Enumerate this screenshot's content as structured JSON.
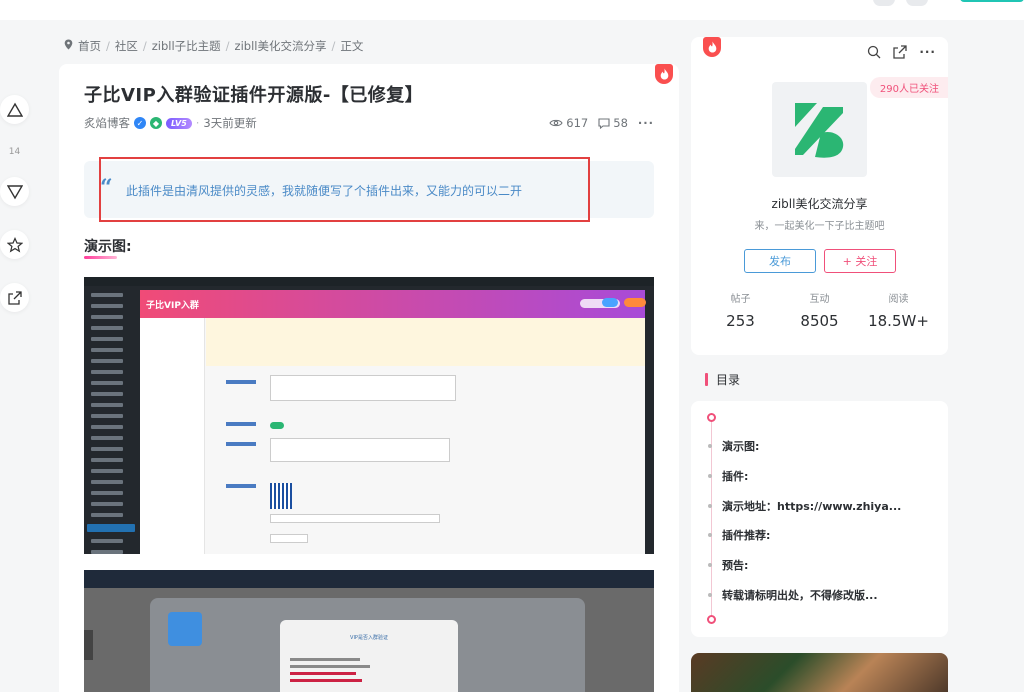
{
  "breadcrumb": {
    "home": "首页",
    "items": [
      "社区",
      "zibll子比主题",
      "zibll美化交流分享",
      "正文"
    ]
  },
  "vote": {
    "count": "14"
  },
  "post": {
    "title": "子比VIP入群验证插件开源版-【已修复】",
    "author": "炙焰博客",
    "level": "LV5",
    "updated": "3天前更新",
    "views": "617",
    "comments": "58",
    "quote": "此插件是由清风提供的灵感，我就随便写了个插件出来，又能力的可以二开",
    "section_heading": "演示图:",
    "screenshot1_title": "子比VIP入群",
    "screenshot2_dialog_title": "VIP是否入群验证"
  },
  "forum_card": {
    "followers": "290人已关注",
    "name": "zibll美化交流分享",
    "desc": "来，一起美化一下子比主题吧",
    "publish_label": "发布",
    "follow_label": "+ 关注",
    "stats": [
      {
        "label": "帖子",
        "value": "253"
      },
      {
        "label": "互动",
        "value": "8505"
      },
      {
        "label": "阅读",
        "value": "18.5W+"
      }
    ]
  },
  "toc": {
    "title": "目录",
    "items": [
      "演示图:",
      "插件:",
      "演示地址：https://www.zhiya...",
      "插件推荐:",
      "预告:",
      "转载请标明出处，不得修改版..."
    ]
  },
  "colors": {
    "accent": "#f0507a",
    "link": "#4a9ad8",
    "quote": "#4a8ac7",
    "highlight_box": "#e24040"
  }
}
